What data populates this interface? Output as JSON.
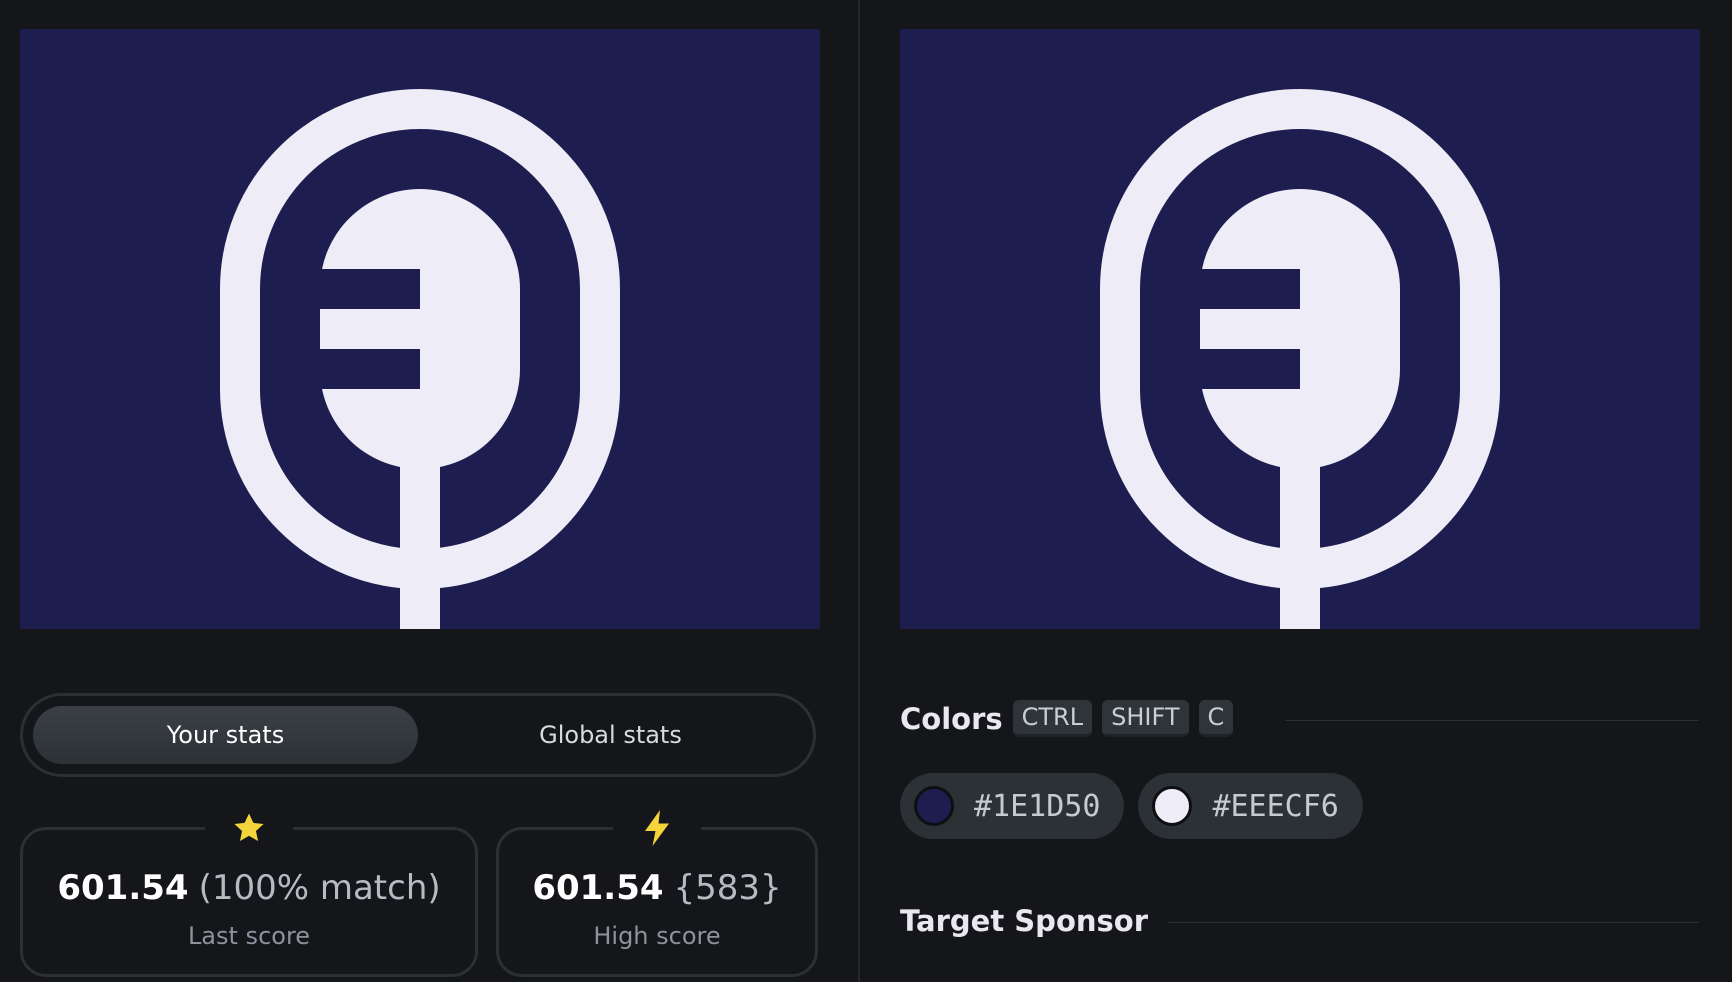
{
  "canvases": {
    "output": {
      "background": "#1E1D50",
      "foreground": "#EEECF6"
    },
    "target": {
      "background": "#1E1D50",
      "foreground": "#EEECF6"
    }
  },
  "stats_toggle": {
    "your_stats": "Your stats",
    "global_stats": "Global stats",
    "active": "your_stats"
  },
  "last_score": {
    "icon": "star-icon",
    "value": "601.54",
    "extra": "(100% match)",
    "label": "Last score"
  },
  "high_score": {
    "icon": "lightning-icon",
    "value": "601.54",
    "extra": "{583}",
    "label": "High score"
  },
  "colors_section": {
    "title": "Colors",
    "shortcut": [
      "CTRL",
      "SHIFT",
      "C"
    ],
    "swatches": [
      {
        "hex": "#1E1D50"
      },
      {
        "hex": "#EEECF6"
      }
    ]
  },
  "sponsor_section": {
    "title": "Target Sponsor"
  },
  "accent_colors": {
    "star": "#F5D33A",
    "bolt": "#F5D33A"
  }
}
